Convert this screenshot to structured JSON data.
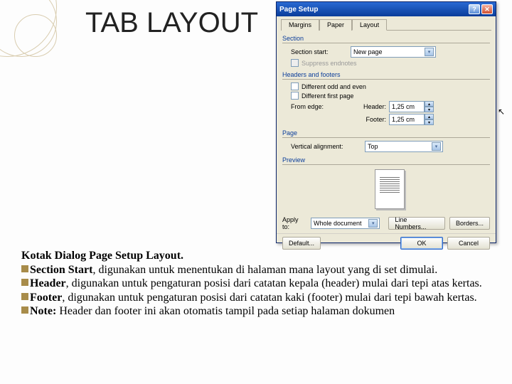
{
  "slide": {
    "title": "TAB LAYOUT"
  },
  "dialog": {
    "title": "Page Setup",
    "tabs": {
      "margins": "Margins",
      "paper": "Paper",
      "layout": "Layout"
    },
    "section": {
      "label": "Section",
      "start_label": "Section start:",
      "start_value": "New page",
      "suppress": "Suppress endnotes"
    },
    "hf": {
      "label": "Headers and footers",
      "odd_even": "Different odd and even",
      "first_page": "Different first page",
      "from_edge": "From edge:",
      "header_label": "Header:",
      "header_value": "1,25 cm",
      "footer_label": "Footer:",
      "footer_value": "1,25 cm"
    },
    "page": {
      "label": "Page",
      "valign_label": "Vertical alignment:",
      "valign_value": "Top"
    },
    "preview": {
      "label": "Preview"
    },
    "apply": {
      "label": "Apply to:",
      "value": "Whole document"
    },
    "buttons": {
      "line_numbers": "Line Numbers...",
      "borders": "Borders...",
      "default": "Default...",
      "ok": "OK",
      "cancel": "Cancel"
    }
  },
  "text": {
    "h": "Kotak Dialog Page Setup Layout.",
    "b1a": "Section Start",
    "b1b": ", digunakan untuk menentukan di halaman mana layout yang di set dimulai.",
    "b2a": "Header",
    "b2b": ", digunakan untuk pengaturan posisi dari catatan kepala (header) mulai dari tepi atas kertas.",
    "b3a": "Footer",
    "b3b": ", digunakan untuk pengaturan posisi dari catatan kaki (footer) mulai dari tepi bawah kertas.",
    "b4a": "Note:",
    "b4b": " Header dan footer ini akan otomatis tampil pada setiap  halaman dokumen"
  }
}
